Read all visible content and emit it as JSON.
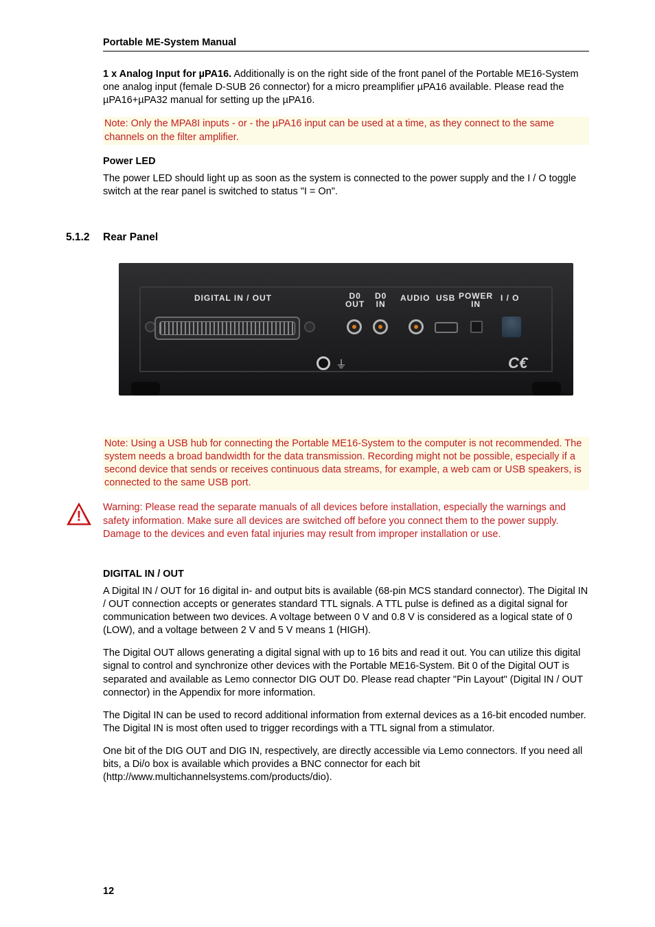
{
  "running_head": "Portable ME-System Manual",
  "section512": {
    "num": "5.1.2",
    "title": "Rear Panel"
  },
  "para": {
    "analog_lead": "1 x Analog Input for µPA16.",
    "analog_body": " Additionally is on the right side of the front panel of the Portable ME16-System one analog input (female D-SUB 26 connector) for a micro preamplifier µPA16 available. Please read the µPA16+µPA32 manual for setting up the µPA16.",
    "note_mpa": "Note: Only the MPA8I inputs - or - the µPA16 input can be used at a time, as they connect to the same channels on the filter amplifier.",
    "power_led_head": "Power LED",
    "power_led_body": "The power LED should light up as soon as the system is connected to the power supply and the I / O toggle switch at the rear panel is switched to status \"I = On\".",
    "note_usb": "Note: Using a USB hub for connecting the Portable ME16-System to the computer is not recommended. The system needs a broad bandwidth for the data transmission. Recording might not be possible, especially if a second device that sends or receives continuous data streams, for example, a web cam or USB speakers, is connected to the same USB port.",
    "warning": "Warning: Please read the separate manuals of all devices before installation, especially the warnings and safety information. Make sure all devices are switched off before you connect them to the power supply. Damage to the devices and even fatal injuries may result from improper installation or use.",
    "dig_head": "DIGITAL IN / OUT",
    "dig_p1": "A Digital IN / OUT for 16 digital in- and output bits is available (68-pin MCS standard connector). The Digital IN / OUT connection accepts or generates standard TTL signals. A TTL pulse is defined as a digital signal for communication between two devices. A voltage between 0 V and 0.8 V is considered as a logical state of 0 (LOW), and a voltage between 2 V and 5 V means 1 (HIGH).",
    "dig_p2": "The Digital OUT allows generating a digital signal with up to 16 bits and read it out. You can utilize this digital signal to control and synchronize other devices with the Portable ME16-System. Bit 0 of the Digital OUT is separated and available as Lemo connector DIG OUT D0. Please read chapter \"Pin Layout\" (Digital IN / OUT connector) in the Appendix for more information.",
    "dig_p3": "The Digital IN can be used to record additional information from external devices as a 16-bit encoded number. The Digital IN is most often used to trigger recordings with a TTL signal from a stimulator.",
    "dig_p4": "One bit of the DIG OUT and DIG IN, respectively, are directly accessible via Lemo connectors. If you need all bits, a Di/o box is available which provides a BNC connector for each bit (http://www.multichannelsystems.com/products/dio)."
  },
  "rear_labels": {
    "digital": "DIGITAL IN / OUT",
    "d0out": "D0\nOUT",
    "d0in": "D0\nIN",
    "audio": "AUDIO",
    "usb": "USB",
    "powerin": "POWER\nIN",
    "io": "I / O",
    "ground": "⏚",
    "ce": "C€"
  },
  "page_number": "12"
}
